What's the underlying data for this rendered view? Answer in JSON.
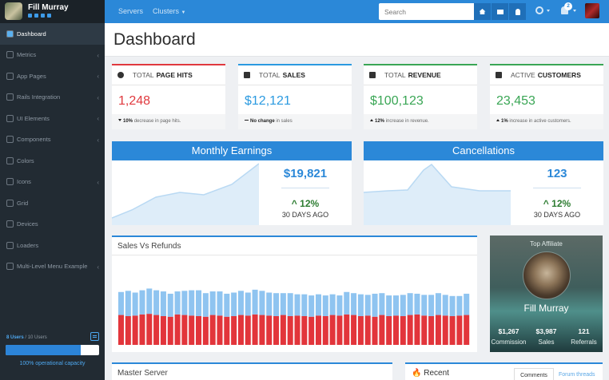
{
  "user": {
    "name": "Fill Murray"
  },
  "sidebar": {
    "items": [
      {
        "label": "Dashboard",
        "chevron": false,
        "icon": "dashboard-icon"
      },
      {
        "label": "Metrics",
        "chevron": true,
        "icon": "chart-icon"
      },
      {
        "label": "App Pages",
        "chevron": true,
        "icon": "folder-icon"
      },
      {
        "label": "Rails Integration",
        "chevron": true,
        "icon": "diamond-icon"
      },
      {
        "label": "UI Elements",
        "chevron": true,
        "icon": "pen-icon"
      },
      {
        "label": "Components",
        "chevron": true,
        "icon": "puzzle-icon"
      },
      {
        "label": "Colors",
        "chevron": false,
        "icon": "palette-icon"
      },
      {
        "label": "Icons",
        "chevron": true,
        "icon": "star-icon"
      },
      {
        "label": "Grid",
        "chevron": false,
        "icon": "grid-icon"
      },
      {
        "label": "Devices",
        "chevron": false,
        "icon": "devices-icon"
      },
      {
        "label": "Loaders",
        "chevron": false,
        "icon": "spinner-icon"
      },
      {
        "label": "Multi-Level Menu Example",
        "chevron": true,
        "icon": "layers-icon"
      }
    ],
    "users_count": "8 Users",
    "users_total": "/ 10 Users",
    "capacity_fraction": 0.8,
    "capacity_label": "100% operational capacity"
  },
  "topbar": {
    "links": [
      "Servers",
      "Clusters"
    ],
    "search_placeholder": "Search",
    "notification_count": "2"
  },
  "page": {
    "title": "Dashboard"
  },
  "stats": [
    {
      "label": "TOTAL",
      "strong": "PAGE HITS",
      "value": "1,248",
      "color": "#e0393e",
      "change": "10%",
      "note": "decrease in page hits.",
      "dir": "down"
    },
    {
      "label": "TOTAL",
      "strong": "SALES",
      "value": "$12,121",
      "color": "#2b9ae0",
      "change": "No change",
      "note": "in sales",
      "dir": "none"
    },
    {
      "label": "TOTAL",
      "strong": "REVENUE",
      "value": "$100,123",
      "color": "#3aa655",
      "change": "12%",
      "note": "increase in revenue.",
      "dir": "up"
    },
    {
      "label": "ACTIVE",
      "strong": "CUSTOMERS",
      "value": "23,453",
      "color": "#3aa655",
      "change": "1%",
      "note": "increase in active customers.",
      "dir": "up"
    }
  ],
  "earnings": [
    {
      "title": "Monthly Earnings",
      "amount": "$19,821",
      "pct": "12%",
      "period": "30 DAYS AGO"
    },
    {
      "title": "Cancellations",
      "amount": "123",
      "pct": "12%",
      "period": "30 DAYS AGO"
    }
  ],
  "sales_chart": {
    "title": "Sales Vs Refunds",
    "chart_data": {
      "type": "bar",
      "stacked": true,
      "series": [
        {
          "color": "#e2353b",
          "values": [
            52,
            50,
            51,
            53,
            54,
            52,
            50,
            49,
            53,
            52,
            51,
            50,
            49,
            52,
            51,
            49,
            50,
            52,
            51,
            53,
            52,
            51,
            50,
            52,
            50,
            51,
            50,
            49,
            51,
            50,
            52,
            51,
            53,
            52,
            50,
            51,
            49,
            52,
            50,
            51,
            50,
            52,
            53,
            51,
            50,
            52,
            51,
            50,
            51,
            52
          ]
        },
        {
          "color": "#8fc4f0",
          "values": [
            40,
            44,
            40,
            42,
            44,
            43,
            43,
            40,
            40,
            42,
            44,
            45,
            41,
            41,
            42,
            40,
            41,
            42,
            40,
            43,
            42,
            40,
            40,
            38,
            40,
            37,
            38,
            37,
            37,
            36,
            36,
            35,
            39,
            38,
            38,
            36,
            40,
            38,
            36,
            35,
            37,
            38,
            36,
            36,
            37,
            38,
            36,
            35,
            34,
            37
          ]
        }
      ]
    }
  },
  "affiliate": {
    "title": "Top Affiliate",
    "name": "Fill Murray",
    "stats": [
      {
        "value": "$1,267",
        "label": "Commission"
      },
      {
        "value": "$3,987",
        "label": "Sales"
      },
      {
        "value": "121",
        "label": "Referrals"
      }
    ]
  },
  "bottom": {
    "master_title": "Master Server",
    "recent_title": "Recent",
    "tabs": [
      "Comments",
      "Forum threads"
    ]
  }
}
